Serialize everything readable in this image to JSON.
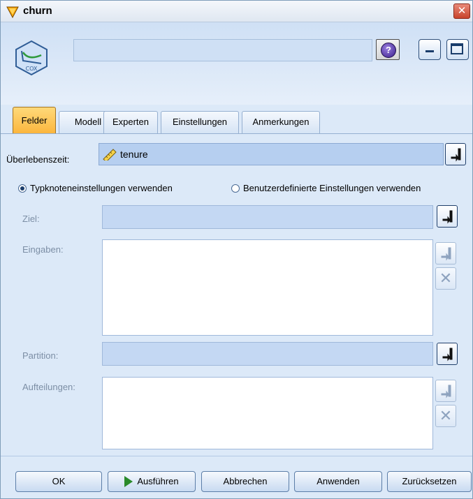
{
  "window": {
    "title": "churn"
  },
  "header": {
    "node_label": "COX",
    "name_value": "",
    "help_label": "?"
  },
  "tabs": [
    {
      "label": "Felder",
      "active": true
    },
    {
      "label": "Modell",
      "active": false
    },
    {
      "label": "Experten",
      "active": false
    },
    {
      "label": "Einstellungen",
      "active": false
    },
    {
      "label": "Anmerkungen",
      "active": false
    }
  ],
  "fields": {
    "survival_label": "Überlebenszeit:",
    "survival_value": "tenure",
    "radio_type_node": "Typknoteneinstellungen verwenden",
    "radio_custom": "Benutzerdefinierte Einstellungen verwenden",
    "target_label": "Ziel:",
    "inputs_label": "Eingaben:",
    "partition_label": "Partition:",
    "splits_label": "Aufteilungen:"
  },
  "buttons": {
    "ok": "OK",
    "run": "Ausführen",
    "cancel": "Abbrechen",
    "apply": "Anwenden",
    "reset": "Zurücksetzen"
  },
  "colors": {
    "accent_tab": "#fbb53c",
    "window_bg": "#dce9f8",
    "close": "#c8432b"
  }
}
